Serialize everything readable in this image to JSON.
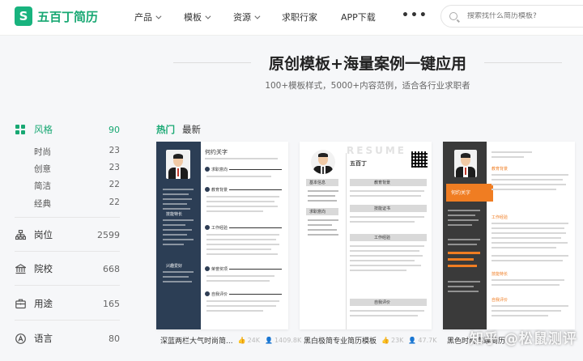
{
  "nav": {
    "logo_mark": "S",
    "logo_text": "五百丁简历",
    "items": [
      {
        "label": "产品",
        "has_dropdown": true
      },
      {
        "label": "模板",
        "has_dropdown": true
      },
      {
        "label": "资源",
        "has_dropdown": true
      },
      {
        "label": "求职行家",
        "has_dropdown": false
      },
      {
        "label": "APP下载",
        "has_dropdown": false
      }
    ],
    "more": "•••",
    "search_placeholder": "搜索找什么简历模板?"
  },
  "hero": {
    "title": "原创模板+海量案例一键应用",
    "subtitle": "100+模板样式，5000+内容范例，适合各行业求职者"
  },
  "sidebar": {
    "categories": [
      {
        "label": "风格",
        "count": "90",
        "icon": "style-grid-icon",
        "active": true,
        "subs": [
          {
            "label": "时尚",
            "count": "23"
          },
          {
            "label": "创意",
            "count": "23"
          },
          {
            "label": "简洁",
            "count": "22"
          },
          {
            "label": "经典",
            "count": "22"
          }
        ]
      },
      {
        "label": "岗位",
        "count": "2599",
        "icon": "org-chart-icon",
        "active": false
      },
      {
        "label": "院校",
        "count": "668",
        "icon": "school-building-icon",
        "active": false
      },
      {
        "label": "用途",
        "count": "165",
        "icon": "briefcase-icon",
        "active": false
      },
      {
        "label": "语言",
        "count": "80",
        "icon": "language-icon",
        "active": false
      }
    ]
  },
  "tabs": [
    {
      "label": "热门",
      "active": true
    },
    {
      "label": "最新",
      "active": false
    }
  ],
  "cards": [
    {
      "caption": "深蓝两栏大气时尚简...",
      "likes": "24K",
      "views": "1409.8K",
      "resume": {
        "name": "何约关字",
        "sections": [
          "求职意向",
          "教育背景",
          "工作经验",
          "荣誉奖项",
          "自我评价"
        ],
        "left_sections": [
          "技能特长",
          "兴趣爱好"
        ]
      }
    },
    {
      "caption": "黑白极简专业简历模板",
      "likes": "23K",
      "views": "47.7K",
      "resume": {
        "watermark": "RESUME",
        "name": "五百丁",
        "sections": [
          "基本信息",
          "求职意向",
          "教育背景",
          "技能证书",
          "工作经验",
          "自我评价"
        ]
      }
    },
    {
      "caption": "黑色时尚高端简历",
      "likes": "",
      "views": "",
      "resume": {
        "name": "何约关字",
        "sections": [
          "教育背景",
          "工作经验",
          "技能特长",
          "自我评价"
        ]
      }
    }
  ],
  "watermark": "知乎 @松鼠测评",
  "colors": {
    "brand_green": "#18a873",
    "card1_sidebar": "#2c3e55",
    "card3_accent": "#f07d22",
    "card3_sidebar": "#3a3a3a"
  }
}
